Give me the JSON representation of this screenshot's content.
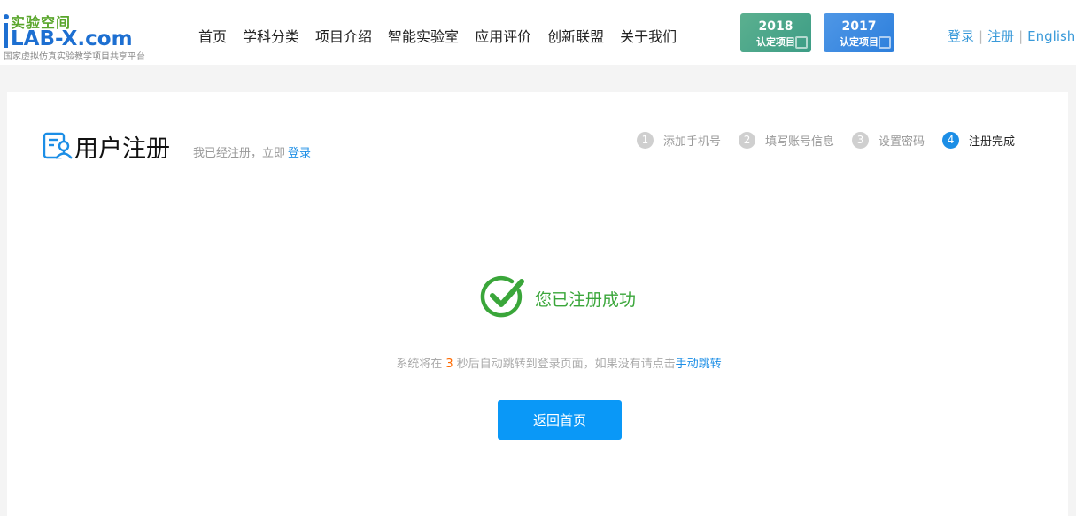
{
  "logo": {
    "cn": "实验空间",
    "en": "LAB-X.com",
    "subtitle": "国家虚拟仿真实验教学项目共享平台"
  },
  "nav": {
    "items": [
      "首页",
      "学科分类",
      "项目介绍",
      "智能实验室",
      "应用评价",
      "创新联盟",
      "关于我们"
    ]
  },
  "badges": [
    {
      "year": "2018",
      "label": "认定项目",
      "color": "#4aa78a"
    },
    {
      "year": "2017",
      "label": "认定项目",
      "color": "#3b8be1"
    }
  ],
  "auth": {
    "login": "登录",
    "register": "注册",
    "english": "English"
  },
  "page": {
    "title": "用户注册",
    "note": "我已经注册，立即",
    "note_link": "登录"
  },
  "steps": [
    {
      "num": "1",
      "label": "添加手机号"
    },
    {
      "num": "2",
      "label": "填写账号信息"
    },
    {
      "num": "3",
      "label": "设置密码"
    },
    {
      "num": "4",
      "label": "注册完成"
    }
  ],
  "result": {
    "message": "您已注册成功",
    "redirect_prefix": "系统将在",
    "countdown": "3",
    "redirect_suffix": "秒后自动跳转到登录页面，如果没有请点击",
    "manual_link": "手动跳转",
    "home_button": "返回首页"
  },
  "colors": {
    "accent": "#0a98f7",
    "success": "#3aa63a",
    "countdown": "#ff6a00"
  }
}
